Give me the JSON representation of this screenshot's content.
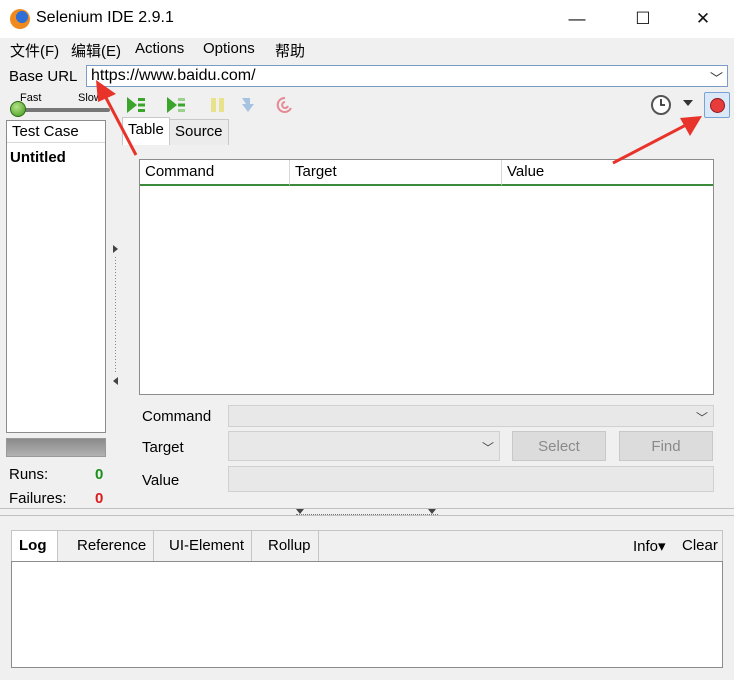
{
  "window": {
    "title": "Selenium IDE 2.9.1",
    "minimize_glyph": "—",
    "maximize_glyph": "☐",
    "close_glyph": "✕"
  },
  "menu": {
    "items": [
      "文件(F)",
      "编辑(E)",
      "Actions",
      "Options",
      "帮助"
    ]
  },
  "base_url": {
    "label": "Base URL",
    "value": "https://www.baidu.com/"
  },
  "toolbar": {
    "speed_fast": "Fast",
    "speed_slow": "Slow",
    "icons": [
      "play-all-icon",
      "play-current-icon",
      "pause-icon",
      "step-icon",
      "rollup-icon",
      "schedule-clock-icon",
      "dropdown-caret-icon",
      "record-icon"
    ]
  },
  "test_case": {
    "header": "Test Case",
    "items": [
      "Untitled"
    ],
    "runs_label": "Runs:",
    "runs_value": "0",
    "failures_label": "Failures:",
    "failures_value": "0"
  },
  "editor_tabs": [
    "Table",
    "Source"
  ],
  "table": {
    "columns": [
      "Command",
      "Target",
      "Value"
    ],
    "rows": []
  },
  "fields": {
    "command_label": "Command",
    "target_label": "Target",
    "value_label": "Value",
    "select_button": "Select",
    "find_button": "Find"
  },
  "log_panel": {
    "tabs": [
      "Log",
      "Reference",
      "UI-Element",
      "Rollup"
    ],
    "info_label": "Info▾",
    "clear_label": "Clear"
  },
  "colors": {
    "accent_border": "#7a9cc7",
    "header_rule": "#3c8a3c",
    "runs_color": "#1a8f1a",
    "failures_color": "#d91c1c",
    "annotation_arrow": "#e8332a"
  }
}
